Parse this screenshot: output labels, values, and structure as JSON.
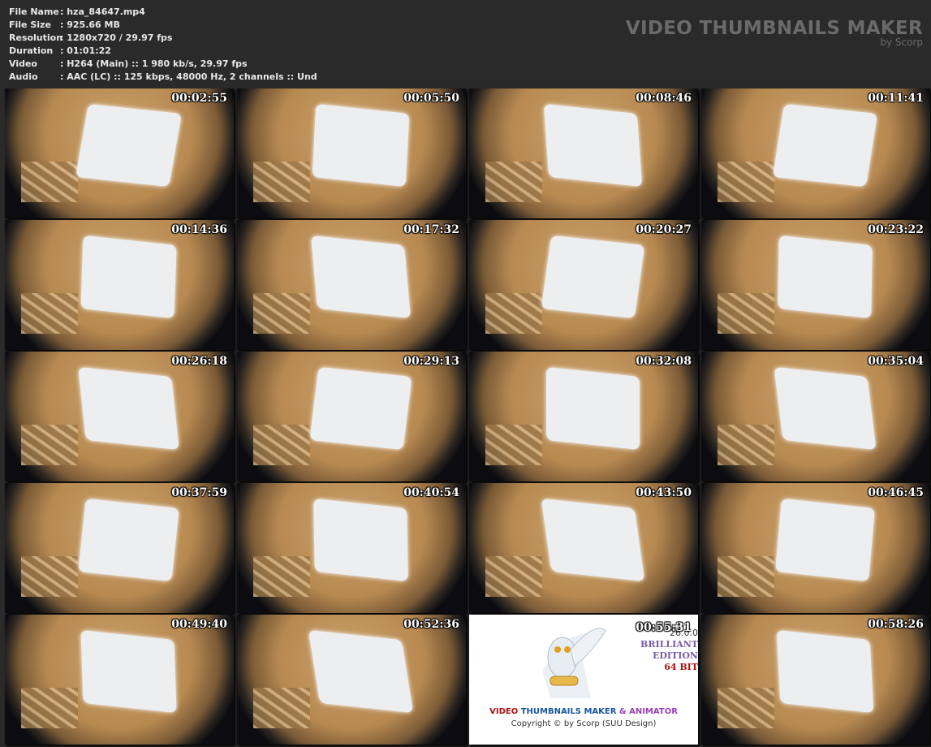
{
  "file_info": [
    {
      "label": "File Name",
      "value": ": hza_84647.mp4"
    },
    {
      "label": "File Size",
      "value": ": 925.66 MB"
    },
    {
      "label": "Resolution",
      "value": ": 1280x720 / 29.97 fps"
    },
    {
      "label": "Duration",
      "value": ": 01:01:22"
    },
    {
      "label": "Video",
      "value": ": H264 (Main) :: 1 980 kb/s, 29.97 fps"
    },
    {
      "label": "Audio",
      "value": ": AAC (LC) :: 125 kbps, 48000 Hz, 2 channels :: Und"
    }
  ],
  "brand": {
    "title": "VIDEO THUMBNAILS MAKER",
    "subtitle": "by Scorp"
  },
  "thumbnails": [
    "00:02:55",
    "00:05:50",
    "00:08:46",
    "00:11:41",
    "00:14:36",
    "00:17:32",
    "00:20:27",
    "00:23:22",
    "00:26:18",
    "00:29:13",
    "00:32:08",
    "00:35:04",
    "00:37:59",
    "00:40:54",
    "00:43:50",
    "00:46:45",
    "00:49:40",
    "00:52:36",
    "00:55:31",
    "00:58:26"
  ],
  "logo_tile": {
    "index": 18,
    "version": "26.0.0",
    "edition_1": "BRILLIANT",
    "edition_2": "EDITION",
    "bits": "64 BIT",
    "name_1": "VIDEO",
    "name_2": "THUMBNAILS MAKER",
    "name_3": "& ANIMATOR",
    "copyright": "Copyright © by Scorp (SUU Design)"
  }
}
